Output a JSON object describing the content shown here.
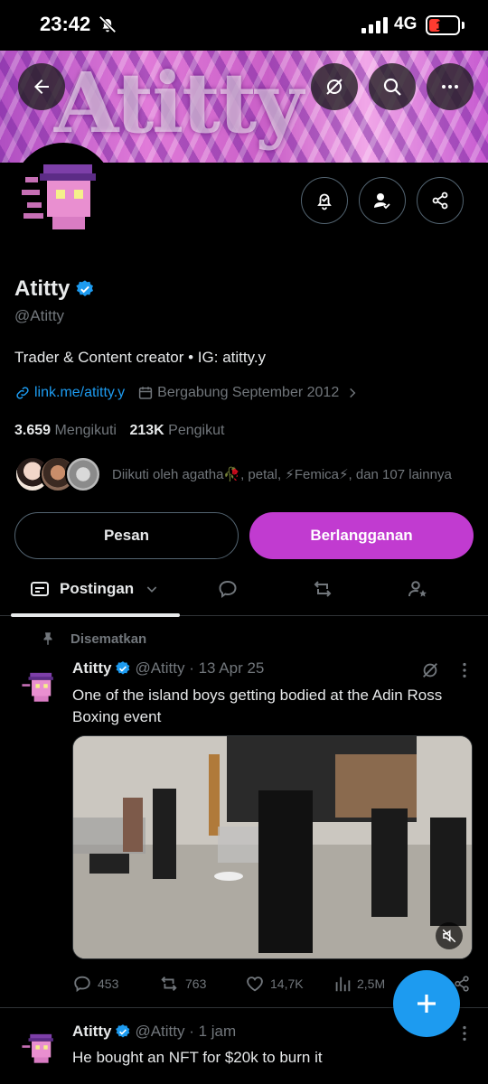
{
  "status_bar": {
    "time": "23:42",
    "network": "4G",
    "battery": "14",
    "battery_level_percent": 14,
    "icons": [
      "bell-slash-icon",
      "signal-icon"
    ]
  },
  "banner": {
    "art_text": "Atitty"
  },
  "profile": {
    "name": "Atitty",
    "handle": "@Atitty",
    "bio": "Trader & Content creator • IG: atitty.y",
    "link": "link.me/atitty.y",
    "joined": "Bergabung September 2012",
    "following_count": "3.659",
    "following_label": "Mengikuti",
    "followers_count": "213K",
    "followers_label": "Pengikut",
    "followed_by": "Diikuti oleh agatha🥀, petal, ⚡Femica⚡, dan 107 lainnya"
  },
  "buttons": {
    "message": "Pesan",
    "subscribe": "Berlangganan"
  },
  "tabs": {
    "posts_label": "Postingan"
  },
  "pinned_label": "Disematkan",
  "tweets": [
    {
      "name": "Atitty",
      "meta": "@Atitty · 13 Apr 25",
      "text": "One of the island boys getting bodied at the Adin Ross Boxing event",
      "replies": "453",
      "retweets": "763",
      "likes": "14,7K",
      "views": "2,5M"
    },
    {
      "name": "Atitty",
      "meta": "@Atitty · 1 jam",
      "text": "He bought an NFT for $20k to burn it"
    }
  ],
  "colors": {
    "accent": "#1d9bf0",
    "subscribe": "#c13bd0",
    "background": "#000000",
    "muted": "#71767b"
  }
}
